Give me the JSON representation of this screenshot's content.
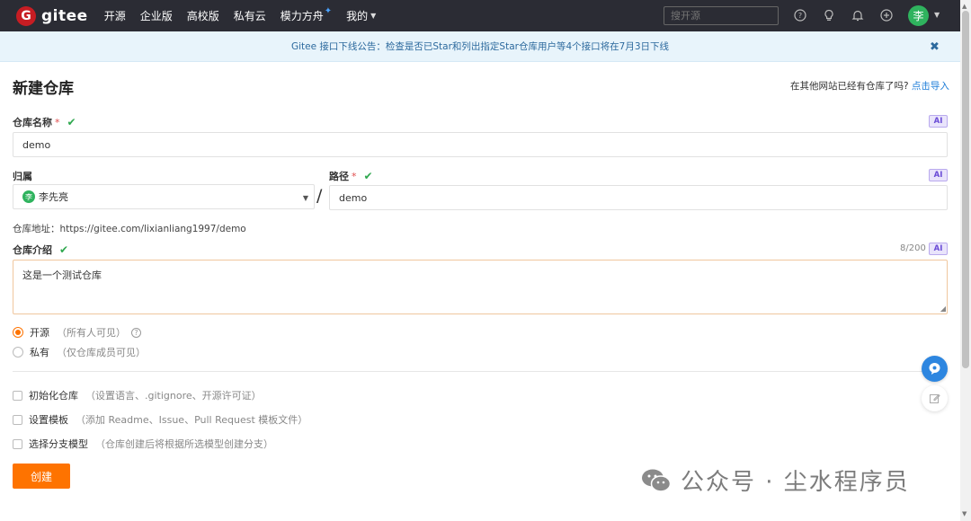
{
  "header": {
    "logo_letter": "G",
    "logo_text": "gitee",
    "nav": [
      {
        "label": "开源"
      },
      {
        "label": "企业版"
      },
      {
        "label": "高校版"
      },
      {
        "label": "私有云"
      },
      {
        "label": "模力方舟"
      },
      {
        "label": "我的"
      }
    ],
    "search_placeholder": "搜开源",
    "avatar_initial": "李",
    "icons": [
      "help-icon",
      "lightbulb-icon",
      "bell-icon",
      "plus-icon"
    ]
  },
  "notice": {
    "text": "Gitee 接口下线公告：检查是否已Star和列出指定Star仓库用户等4个接口将在7月3日下线",
    "close": "✖"
  },
  "page": {
    "title": "新建仓库",
    "import_prefix": "在其他网站已经有仓库了吗?",
    "import_link": "点击导入"
  },
  "form": {
    "ai_label": "AI",
    "repo_name": {
      "label": "仓库名称",
      "required": "*",
      "value": "demo"
    },
    "owner": {
      "label": "归属",
      "avatar_initial": "李",
      "value": "李先亮"
    },
    "path": {
      "label": "路径",
      "required": "*",
      "value": "demo"
    },
    "slash": "/",
    "repo_url": "仓库地址：https://gitee.com/lixianliang1997/demo",
    "description": {
      "label": "仓库介绍",
      "counter": "8/200",
      "value": "这是一个测试仓库"
    },
    "visibility": [
      {
        "label": "开源",
        "hint": "（所有人可见）",
        "selected": true
      },
      {
        "label": "私有",
        "hint": "（仅仓库成员可见）",
        "selected": false
      }
    ],
    "options": [
      {
        "label": "初始化仓库",
        "hint": "（设置语言、.gitignore、开源许可证）"
      },
      {
        "label": "设置模板",
        "hint": "（添加 Readme、Issue、Pull Request 模板文件）"
      },
      {
        "label": "选择分支模型",
        "hint": "（仓库创建后将根据所选模型创建分支）"
      }
    ],
    "submit_label": "创建"
  },
  "watermark": {
    "text": "公众号 · 尘水程序员"
  },
  "colors": {
    "primary": "#fe7300",
    "nav_bg": "#2b2c34",
    "link": "#1d7dd8",
    "check": "#2fa84f"
  }
}
